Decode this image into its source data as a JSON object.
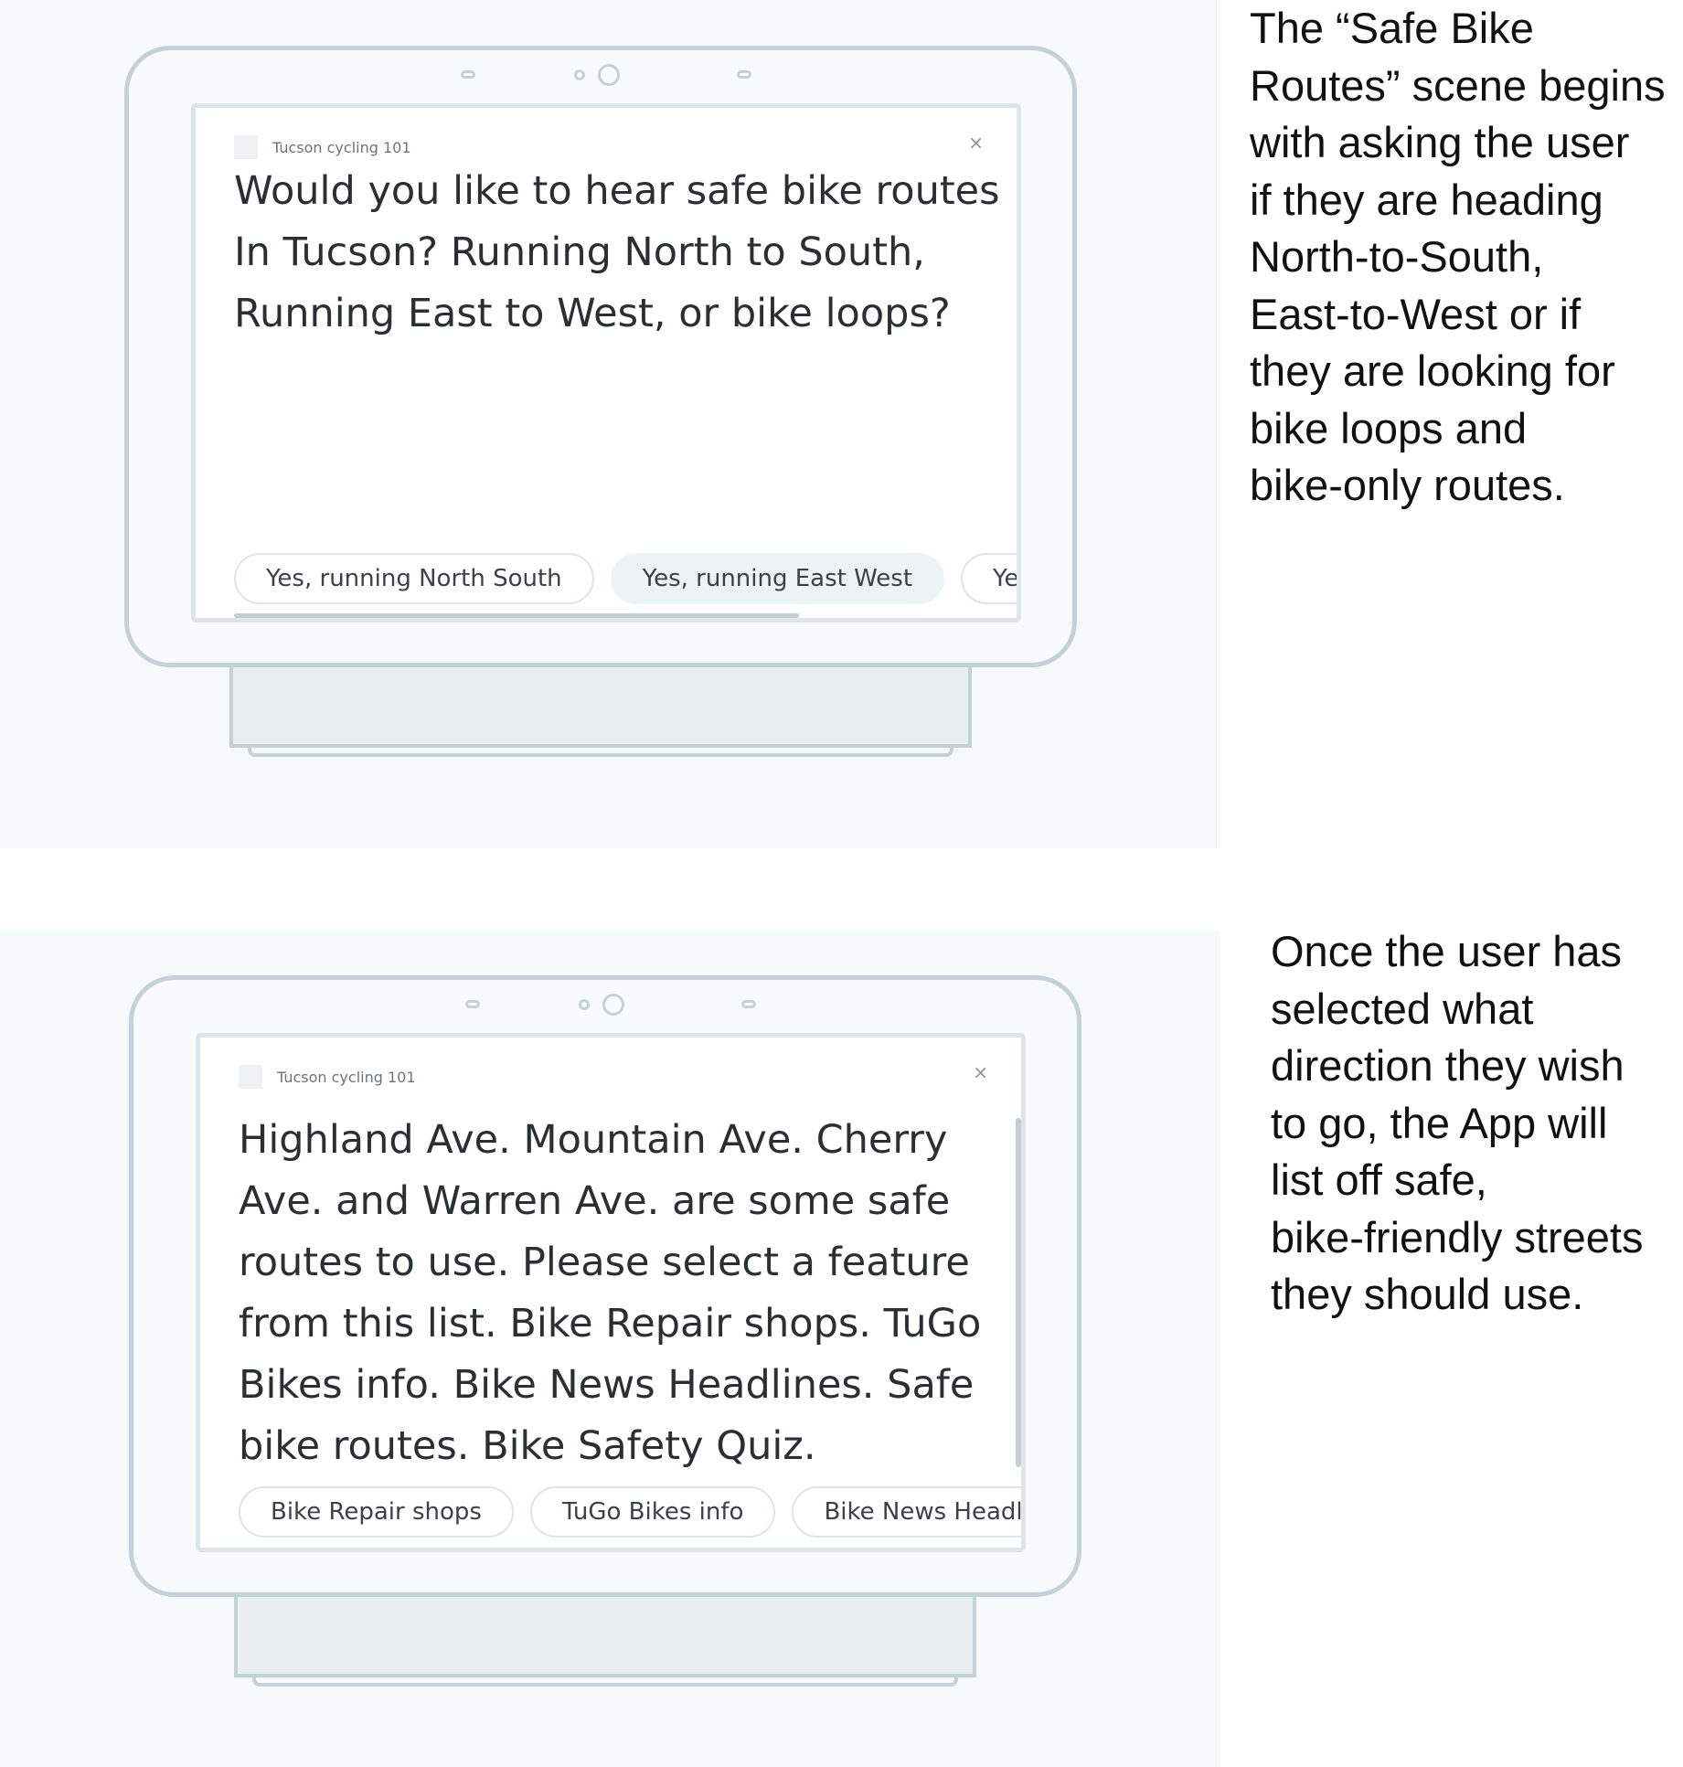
{
  "scene1": {
    "app_name": "Tucson cycling 101",
    "close_glyph": "×",
    "prompt": "Would you like to hear safe bike routes\nIn Tucson? Running North to South,\nRunning East to West, or bike loops?",
    "chips": [
      "Yes, running North South",
      "Yes, running East West",
      "Yes"
    ],
    "selected_chip_index": 1,
    "caption": "The “Safe Bike\nRoutes” scene begins\nwith asking the user\nif they are heading\nNorth-to-South,\nEast-to-West or if\nthey are looking for\nbike loops and\nbike-only routes."
  },
  "scene2": {
    "app_name": "Tucson cycling 101",
    "close_glyph": "×",
    "prompt": "Highland Ave. Mountain Ave. Cherry\nAve. and Warren Ave. are some safe\nroutes to use. Please select a feature\nfrom this list. Bike Repair shops. TuGo\nBikes info. Bike News Headlines. Safe\nbike routes. Bike Safety Quiz.",
    "chips": [
      "Bike Repair shops",
      "TuGo Bikes info",
      "Bike News Headlines"
    ],
    "caption": "Once the user has\nselected what\ndirection they wish\nto go, the App will\nlist off safe,\nbike-friendly streets\nthey should use."
  }
}
